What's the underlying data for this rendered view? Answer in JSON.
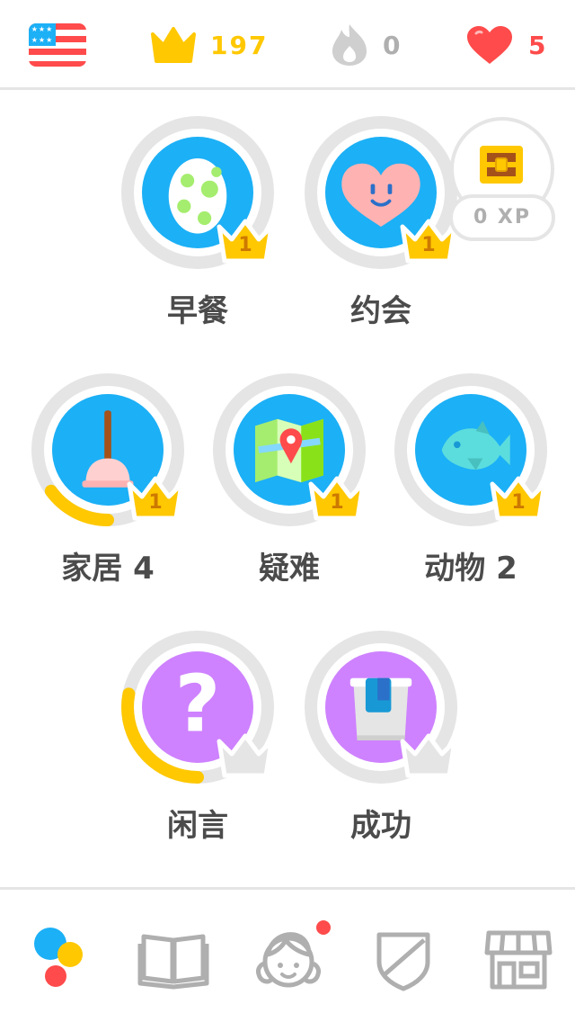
{
  "header": {
    "language_flag": "us-flag-icon",
    "crowns": "197",
    "streak": "0",
    "hearts": "5"
  },
  "chest": {
    "xp_label": "0 XP"
  },
  "skills": [
    {
      "label": "早餐",
      "icon": "egg-icon",
      "crown_level": "1",
      "color": "#1cb0f6",
      "progress": 0
    },
    {
      "label": "约会",
      "icon": "heart-face-icon",
      "crown_level": "1",
      "color": "#1cb0f6",
      "progress": 0
    },
    {
      "label": "家居 4",
      "icon": "plunger-icon",
      "crown_level": "1",
      "color": "#1cb0f6",
      "progress": 0.15
    },
    {
      "label": "疑难",
      "icon": "map-pin-icon",
      "crown_level": "1",
      "color": "#1cb0f6",
      "progress": 0
    },
    {
      "label": "动物 2",
      "icon": "fish-icon",
      "crown_level": "1",
      "color": "#1cb0f6",
      "progress": 0
    },
    {
      "label": "闲言",
      "icon": "question-mark-icon",
      "crown_level": "",
      "color": "#ce82ff",
      "progress": 0.28
    },
    {
      "label": "成功",
      "icon": "paint-bucket-icon",
      "crown_level": "",
      "color": "#ce82ff",
      "progress": 0
    }
  ],
  "colors": {
    "crown": "#ffc800",
    "heart": "#ff4b4b",
    "progress": "#ffc800",
    "ring": "#e5e5e5",
    "blue": "#1cb0f6",
    "purple": "#ce82ff"
  },
  "bottom_nav": [
    {
      "name": "learn-tab",
      "icon": "learn-dots-icon"
    },
    {
      "name": "stories-tab",
      "icon": "book-icon"
    },
    {
      "name": "profile-tab",
      "icon": "avatar-icon",
      "notification": true
    },
    {
      "name": "leagues-tab",
      "icon": "shield-icon"
    },
    {
      "name": "shop-tab",
      "icon": "shop-icon"
    }
  ]
}
